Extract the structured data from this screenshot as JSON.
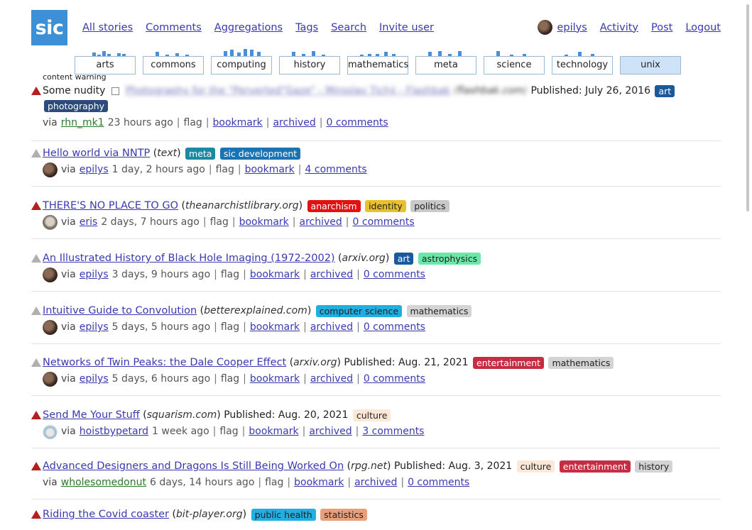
{
  "logo": "sic",
  "nav": [
    "All stories",
    "Comments",
    "Aggregations",
    "Tags",
    "Search",
    "Invite user"
  ],
  "user": {
    "name": "epilys",
    "links": [
      "Activity",
      "Post",
      "Logout"
    ]
  },
  "tabs": [
    {
      "label": "arts",
      "bars": [
        0.1,
        0.4,
        0.2,
        0.6,
        0.3,
        0.1,
        0.35,
        0.3
      ]
    },
    {
      "label": "commons",
      "bars": [
        0.5,
        0.2,
        0.35,
        0.2
      ]
    },
    {
      "label": "computing",
      "bars": [
        0.6,
        0.7,
        0.4,
        0.8,
        0.7,
        0.5
      ]
    },
    {
      "label": "history",
      "bars": [
        0.5,
        0.3,
        0.6,
        0.2
      ]
    },
    {
      "label": "mathematics",
      "bars": [
        0.2,
        0.3,
        0.25,
        0.5,
        0.3
      ]
    },
    {
      "label": "meta",
      "bars": [
        0.5,
        0.6,
        0.3,
        0.6
      ]
    },
    {
      "label": "science",
      "bars": [
        0.6,
        0.2,
        0.3
      ]
    },
    {
      "label": "technology",
      "bars": [
        0.2,
        0.5,
        0.3
      ]
    },
    {
      "label": "unix",
      "bars": []
    }
  ],
  "active_tab": "unix",
  "content_warning_label": "content warning",
  "colors": {
    "accent": "#3d8fd6",
    "link": "#3a3ab0",
    "downvote_red": "#b42020"
  },
  "stories": [
    {
      "title": "Photography for the \"Perverted\"Gaze\" - Miroslav Tichý - Flashbak",
      "domain": "flashbak.com",
      "blurred": true,
      "cw": "Some nudity",
      "published": "Published: July 26, 2016",
      "tags": [
        {
          "name": "art",
          "bg": "#1a5a9c",
          "fg": "#fff"
        },
        {
          "name": "photography",
          "bg": "#2b4b7c",
          "fg": "#fff"
        }
      ],
      "via": "rhn_mk1",
      "via_color": "#2a7a2a",
      "age": "23 hours ago",
      "avatar": "",
      "bookmark": "bookmark",
      "archived": "archived",
      "comments": "0 comments",
      "vote": "red"
    },
    {
      "title": "Hello world via NNTP",
      "domain": "text",
      "published": "",
      "tags": [
        {
          "name": "meta",
          "bg": "#1c89a3",
          "fg": "#fff"
        },
        {
          "name": "sic development",
          "bg": "#1a73b3",
          "fg": "#fff"
        }
      ],
      "via": "epilys",
      "age": "1 day, 2 hours ago",
      "avatar": "epilys",
      "bookmark": "bookmark",
      "archived": "",
      "comments": "4 comments",
      "vote": "grey"
    },
    {
      "title": "THERE'S NO PLACE TO GO",
      "domain": "theanarchistlibrary.org",
      "published": "",
      "tags": [
        {
          "name": "anarchism",
          "bg": "#e21212",
          "fg": "#fff"
        },
        {
          "name": "identity",
          "bg": "#e8c12c",
          "fg": "#222"
        },
        {
          "name": "politics",
          "bg": "#c9c9c9",
          "fg": "#222"
        }
      ],
      "via": "eris",
      "age": "2 days, 7 hours ago",
      "avatar": "eris",
      "bookmark": "bookmark",
      "archived": "archived",
      "comments": "0 comments",
      "vote": "red"
    },
    {
      "title": "An Illustrated History of Black Hole Imaging (1972-2002)",
      "domain": "arxiv.org",
      "published": "",
      "tags": [
        {
          "name": "art",
          "bg": "#1a5a9c",
          "fg": "#fff"
        },
        {
          "name": "astrophysics",
          "bg": "#6be8a8",
          "fg": "#222"
        }
      ],
      "via": "epilys",
      "age": "3 days, 9 hours ago",
      "avatar": "epilys",
      "bookmark": "bookmark",
      "archived": "archived",
      "comments": "0 comments",
      "vote": "grey"
    },
    {
      "title": "Intuitive Guide to Convolution",
      "domain": "betterexplained.com",
      "published": "",
      "tags": [
        {
          "name": "computer science",
          "bg": "#22aee0",
          "fg": "#222"
        },
        {
          "name": "mathematics",
          "bg": "#d4d4d4",
          "fg": "#222"
        }
      ],
      "via": "epilys",
      "age": "5 days, 5 hours ago",
      "avatar": "epilys",
      "bookmark": "bookmark",
      "archived": "archived",
      "comments": "0 comments",
      "vote": "grey"
    },
    {
      "title": "Networks of Twin Peaks: the Dale Cooper Effect",
      "domain": "arxiv.org",
      "published": "Published: Aug. 21, 2021",
      "tags": [
        {
          "name": "entertainment",
          "bg": "#c72d42",
          "fg": "#fff"
        },
        {
          "name": "mathematics",
          "bg": "#d4d4d4",
          "fg": "#222"
        }
      ],
      "via": "epilys",
      "age": "5 days, 6 hours ago",
      "avatar": "epilys",
      "bookmark": "bookmark",
      "archived": "archived",
      "comments": "0 comments",
      "vote": "grey"
    },
    {
      "title": "Send Me Your Stuff",
      "domain": "squarism.com",
      "published": "Published: Aug. 20, 2021",
      "tags": [
        {
          "name": "culture",
          "bg": "#fde8d8",
          "fg": "#222"
        }
      ],
      "via": "hoistbypetard",
      "age": "1 week ago",
      "avatar": "cup",
      "bookmark": "bookmark",
      "archived": "archived",
      "comments": "3 comments",
      "vote": "red"
    },
    {
      "title": "Advanced Designers and Dragons Is Still Being Worked On",
      "domain": "rpg.net",
      "published": "Published: Aug. 3, 2021",
      "tags": [
        {
          "name": "culture",
          "bg": "#fde8d8",
          "fg": "#222"
        },
        {
          "name": "entertainment",
          "bg": "#c72d42",
          "fg": "#fff"
        },
        {
          "name": "history",
          "bg": "#d4d4d4",
          "fg": "#222"
        }
      ],
      "via": "wholesomedonut",
      "via_color": "#2a7a2a",
      "age": "6 days, 14 hours ago",
      "avatar": "",
      "bookmark": "bookmark",
      "archived": "archived",
      "comments": "0 comments",
      "vote": "red"
    },
    {
      "title": "Riding the Covid coaster",
      "domain": "bit-player.org",
      "published": "",
      "tags": [
        {
          "name": "public health",
          "bg": "#22aee0",
          "fg": "#222"
        },
        {
          "name": "statistics",
          "bg": "#e8a07a",
          "fg": "#222"
        }
      ],
      "via": "",
      "age": "",
      "avatar": "",
      "bookmark": "",
      "archived": "",
      "comments": "",
      "vote": "red"
    }
  ]
}
